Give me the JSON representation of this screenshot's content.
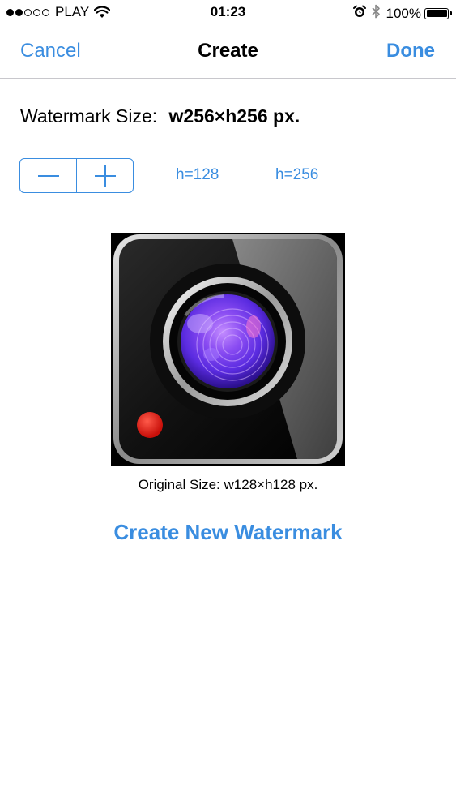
{
  "status_bar": {
    "carrier": "PLAY",
    "signal_bars_filled": 2,
    "signal_bars_total": 5,
    "time": "01:23",
    "battery": "100%",
    "icons": [
      "wifi-icon",
      "alarm-icon",
      "bluetooth-icon",
      "battery-icon"
    ]
  },
  "nav": {
    "cancel_label": "Cancel",
    "title": "Create",
    "done_label": "Done"
  },
  "watermark": {
    "size_label": "Watermark Size:",
    "size_value": "w256×h256 px."
  },
  "stepper": {
    "minus_icon": "minus-icon",
    "plus_icon": "plus-icon"
  },
  "presets": {
    "h128": "h=128",
    "h256": "h=256"
  },
  "image": {
    "icon": "camera-app-icon",
    "original_size": "Original Size: w128×h128 px."
  },
  "actions": {
    "create_new": "Create New Watermark"
  },
  "colors": {
    "accent": "#3a8de0",
    "separator": "#c8c7cc"
  }
}
